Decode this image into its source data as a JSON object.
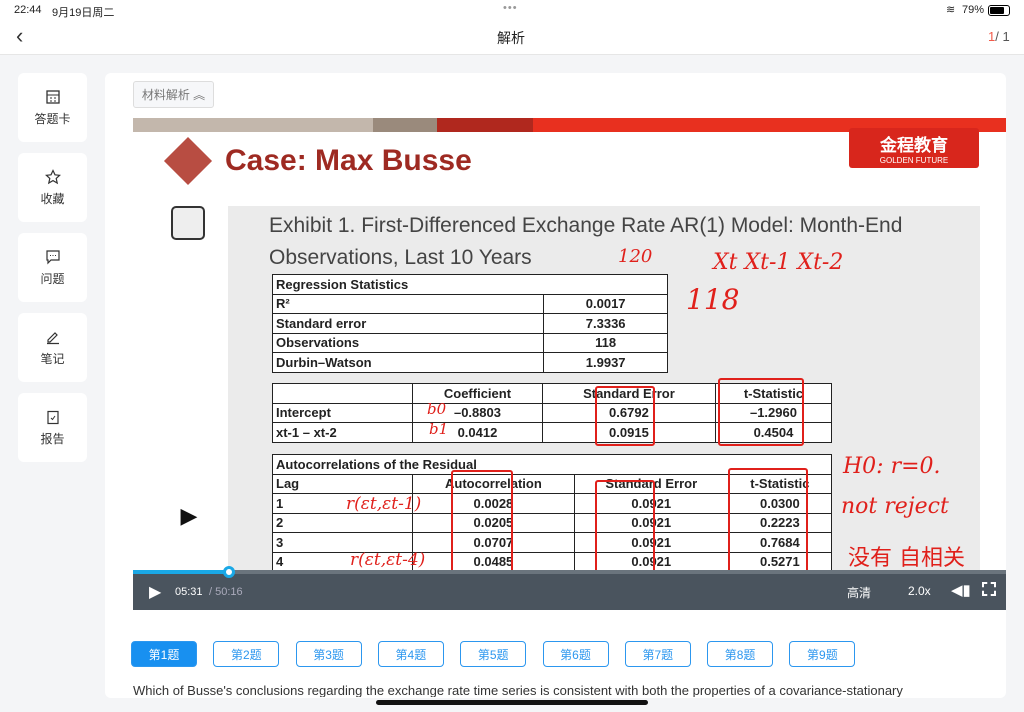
{
  "status": {
    "time": "22:44",
    "date": "9月19日周二",
    "battery": "79%"
  },
  "nav": {
    "title": "解析",
    "page_current": "1",
    "page_total": "/ 1"
  },
  "sidebar": [
    {
      "label": "答题卡",
      "icon": "answer-card-icon"
    },
    {
      "label": "收藏",
      "icon": "star-icon"
    },
    {
      "label": "问题",
      "icon": "chat-icon"
    },
    {
      "label": "笔记",
      "icon": "pen-icon"
    },
    {
      "label": "报告",
      "icon": "report-icon"
    }
  ],
  "material_toggle": "材料解析 ︽",
  "slide": {
    "title": "Case: Max Busse",
    "logo_cn": "金程教育",
    "logo_en": "GOLDEN FUTURE",
    "exhibit_title_1": "Exhibit 1.  First-Differenced Exchange Rate AR(1) Model: Month-End",
    "exhibit_title_2": "Observations, Last 10 Years",
    "regression": {
      "header": "Regression Statistics",
      "rows": [
        [
          "R²",
          "0.0017"
        ],
        [
          "Standard error",
          "7.3336"
        ],
        [
          "Observations",
          "118"
        ],
        [
          "Durbin–Watson",
          "1.9937"
        ]
      ]
    },
    "coef": {
      "headers": [
        "",
        "Coefficient",
        "Standard Error",
        "t-Statistic"
      ],
      "rows": [
        [
          "Intercept",
          "–0.8803",
          "0.6792",
          "–1.2960"
        ],
        [
          "xt-1 – xt-2",
          "0.0412",
          "0.0915",
          "0.4504"
        ]
      ]
    },
    "autocorr": {
      "title": "Autocorrelations of the Residual",
      "headers": [
        "Lag",
        "Autocorrelation",
        "Standard Error",
        "t-Statistic"
      ],
      "rows": [
        [
          "1",
          "0.0028",
          "0.0921",
          "0.0300"
        ],
        [
          "2",
          "0.0205",
          "0.0921",
          "0.2223"
        ],
        [
          "3",
          "0.0707",
          "0.0921",
          "0.7684"
        ],
        [
          "4",
          "0.0485",
          "0.0921",
          "0.5271"
        ]
      ]
    },
    "annotations": [
      "120",
      "118",
      "Xt  Xt-1  Xt-2",
      "H0: r=0.",
      "not reject",
      "没有 自相关",
      "b0",
      "b1",
      "r(εt,εt-1)",
      "r(εt,εt-4)"
    ]
  },
  "player": {
    "time_current": "05:31",
    "time_total": "/ 50:16",
    "quality": "高清",
    "speed": "2.0x",
    "progress": 0.11
  },
  "questions": [
    "第1题",
    "第2题",
    "第3题",
    "第4题",
    "第5题",
    "第6题",
    "第7题",
    "第8题",
    "第9题"
  ],
  "question_text": "Which of Busse's conclusions regarding the exchange rate time series is consistent with both the properties of a covariance-stationary"
}
